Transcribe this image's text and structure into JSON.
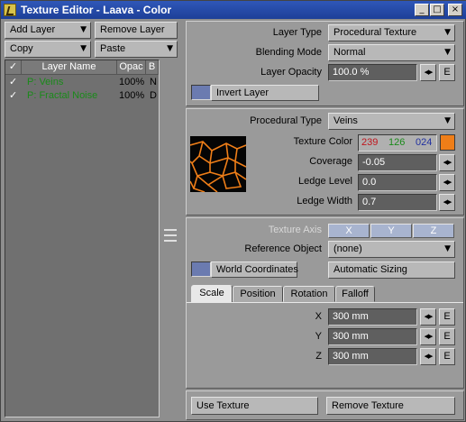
{
  "window": {
    "title": "Texture Editor - Laava - Color",
    "controls": [
      "_",
      "□",
      "×"
    ]
  },
  "left": {
    "add_layer": "Add Layer",
    "remove_layer": "Remove Layer",
    "copy": "Copy",
    "paste": "Paste",
    "columns": [
      "✓",
      "Layer Name",
      "Opac",
      "B"
    ],
    "rows": [
      {
        "check": "✓",
        "name": "P: Veins",
        "opacity": "100%",
        "blend": "N"
      },
      {
        "check": "✓",
        "name": "P: Fractal Noise",
        "opacity": "100%",
        "blend": "D"
      }
    ]
  },
  "layer": {
    "type_label": "Layer Type",
    "type_value": "Procedural Texture",
    "blend_label": "Blending Mode",
    "blend_value": "Normal",
    "opacity_label": "Layer Opacity",
    "opacity_value": "100.0 %",
    "invert_label": "Invert Layer",
    "e_label": "E"
  },
  "procedural": {
    "type_label": "Procedural Type",
    "type_value": "Veins",
    "color_label": "Texture Color",
    "color_r": "239",
    "color_g": "126",
    "color_b": "024",
    "swatch_color": "#ef7e18",
    "coverage_label": "Coverage",
    "coverage_value": "-0.05",
    "ledge_level_label": "Ledge Level",
    "ledge_level_value": "0.0",
    "ledge_width_label": "Ledge Width",
    "ledge_width_value": "0.7"
  },
  "mapping": {
    "axis_label": "Texture Axis",
    "axis_x": "X",
    "axis_y": "Y",
    "axis_z": "Z",
    "ref_label": "Reference Object",
    "ref_value": "(none)",
    "world_label": "World Coordinates",
    "auto_sizing": "Automatic Sizing",
    "tabs": [
      "Scale",
      "Position",
      "Rotation",
      "Falloff"
    ],
    "x_label": "X",
    "x_value": "300 mm",
    "y_label": "Y",
    "y_value": "300 mm",
    "z_label": "Z",
    "z_value": "300 mm",
    "e_label": "E"
  },
  "footer": {
    "use_texture": "Use Texture",
    "remove_texture": "Remove Texture"
  },
  "colors": {
    "title_bar": "#1d3f98",
    "accent_blue": "#6b7bb0",
    "red": "#c0141c",
    "green": "#1a8a1a",
    "blue": "#2030a0"
  }
}
